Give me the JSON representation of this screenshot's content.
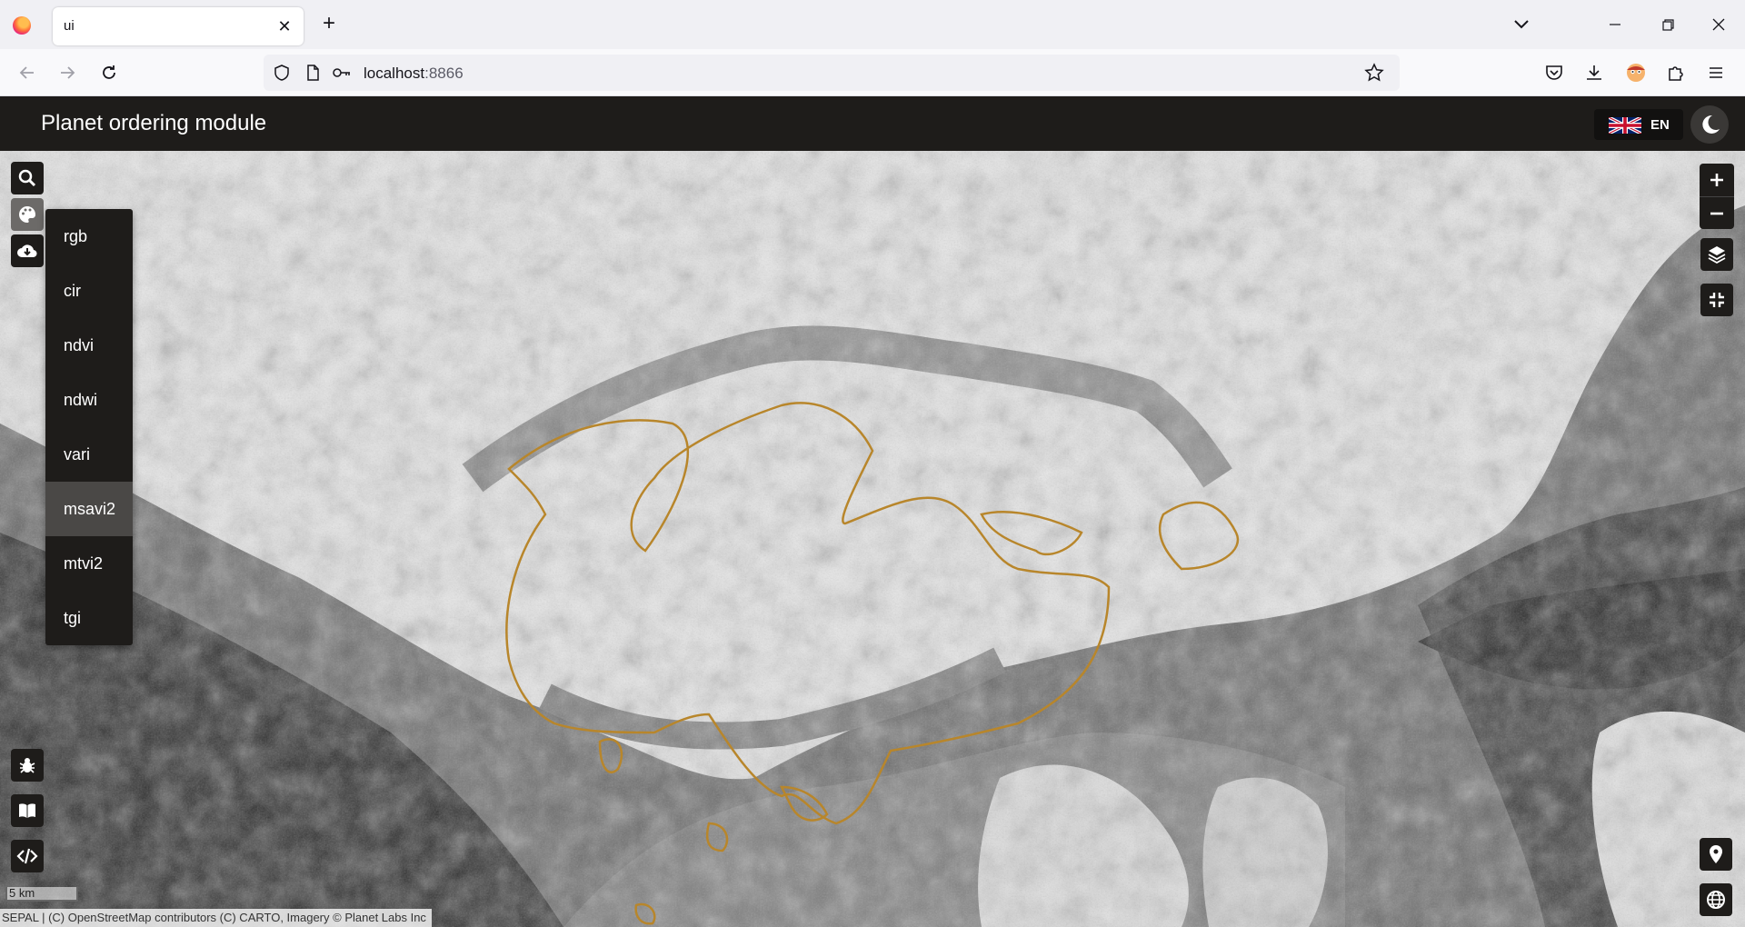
{
  "browser": {
    "tab_title": "ui",
    "url_host": "localhost",
    "url_port": ":8866"
  },
  "app": {
    "title": "Planet ordering module",
    "language": "EN",
    "theme_icon": "moon-icon"
  },
  "map": {
    "left_controls": [
      "search-icon",
      "palette-icon",
      "cloud-download-icon"
    ],
    "color_menu": {
      "items": [
        "rgb",
        "cir",
        "ndvi",
        "ndwi",
        "vari",
        "msavi2",
        "mtvi2",
        "tgi"
      ],
      "selected": "msavi2"
    },
    "right_controls": [
      "zoom-in-icon",
      "zoom-out-icon",
      "layers-icon",
      "fullscreen-exit-icon"
    ],
    "bottom_left_controls": [
      "bug-icon",
      "book-icon",
      "code-icon"
    ],
    "bottom_right_controls": [
      "map-marker-icon",
      "globe-icon"
    ],
    "scale": "5 km",
    "attribution": "SEPAL | (C) OpenStreetMap contributors (C) CARTO, Imagery © Planet Labs Inc",
    "aoi_outline_color": "#b8862b"
  }
}
